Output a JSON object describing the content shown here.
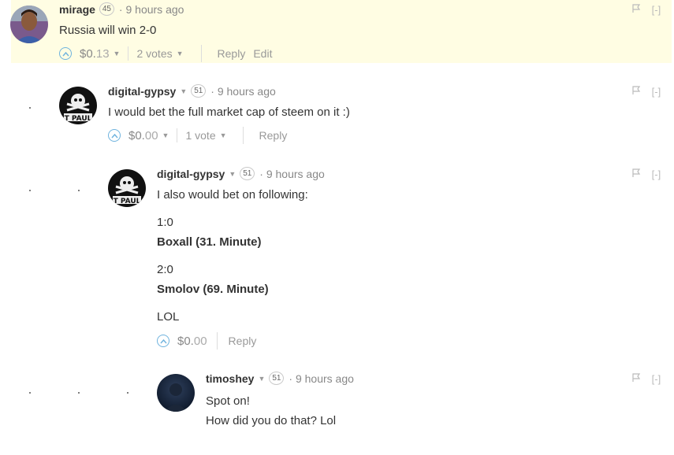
{
  "comments": [
    {
      "author": "mirage",
      "reputation": "45",
      "time": "9 hours ago",
      "lines": [
        "Russia will win 2-0"
      ],
      "payout_main": "$0.",
      "payout_dec": "13",
      "votes": "2 votes",
      "reply": "Reply",
      "edit": "Edit",
      "collapse": "[-]"
    },
    {
      "author": "digital-gypsy",
      "reputation": "51",
      "time": "9 hours ago",
      "lines": [
        "I would bet the full market cap of steem on it :)"
      ],
      "payout_main": "$0.",
      "payout_dec": "00",
      "votes": "1 vote",
      "reply": "Reply",
      "collapse": "[-]"
    },
    {
      "author": "digital-gypsy",
      "reputation": "51",
      "time": "9 hours ago",
      "lines": [
        "I also would bet on following:",
        "1:0",
        "Boxall (31. Minute)",
        "2:0",
        "Smolov (69. Minute)",
        "LOL"
      ],
      "payout_main": "$0.",
      "payout_dec": "00",
      "reply": "Reply",
      "collapse": "[-]"
    },
    {
      "author": "timoshey",
      "reputation": "51",
      "time": "9 hours ago",
      "lines": [
        "Spot on!",
        "How did you do that? Lol"
      ],
      "collapse": "[-]"
    }
  ],
  "colors": {
    "highlight_bg": "#fffde3",
    "upvote_blue": "#6fb3de"
  },
  "icons": {
    "upvote": "chevron-up-circle-icon",
    "dropdown": "caret-down-icon",
    "flag": "flag-icon"
  }
}
